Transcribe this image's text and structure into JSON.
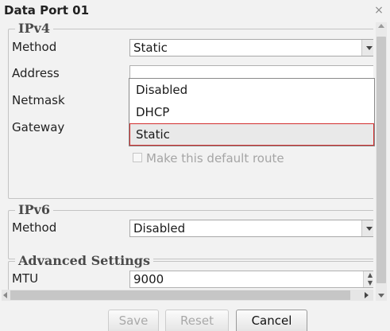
{
  "dialog": {
    "title": "Data Port 01",
    "close_glyph": "×"
  },
  "ipv4": {
    "legend": "IPv4",
    "method_label": "Method",
    "method_value": "Static",
    "address_label": "Address",
    "netmask_label": "Netmask",
    "gateway_label": "Gateway",
    "default_route_label": "Make this default route",
    "dropdown_options": [
      "Disabled",
      "DHCP",
      "Static"
    ],
    "dropdown_highlighted": "Static"
  },
  "ipv6": {
    "legend": "IPv6",
    "method_label": "Method",
    "method_value": "Disabled"
  },
  "advanced": {
    "legend": "Advanced Settings",
    "mtu_label": "MTU",
    "mtu_value": "9000"
  },
  "buttons": {
    "save": "Save",
    "reset": "Reset",
    "cancel": "Cancel"
  },
  "colors": {
    "highlight_border": "#d32f2f"
  }
}
